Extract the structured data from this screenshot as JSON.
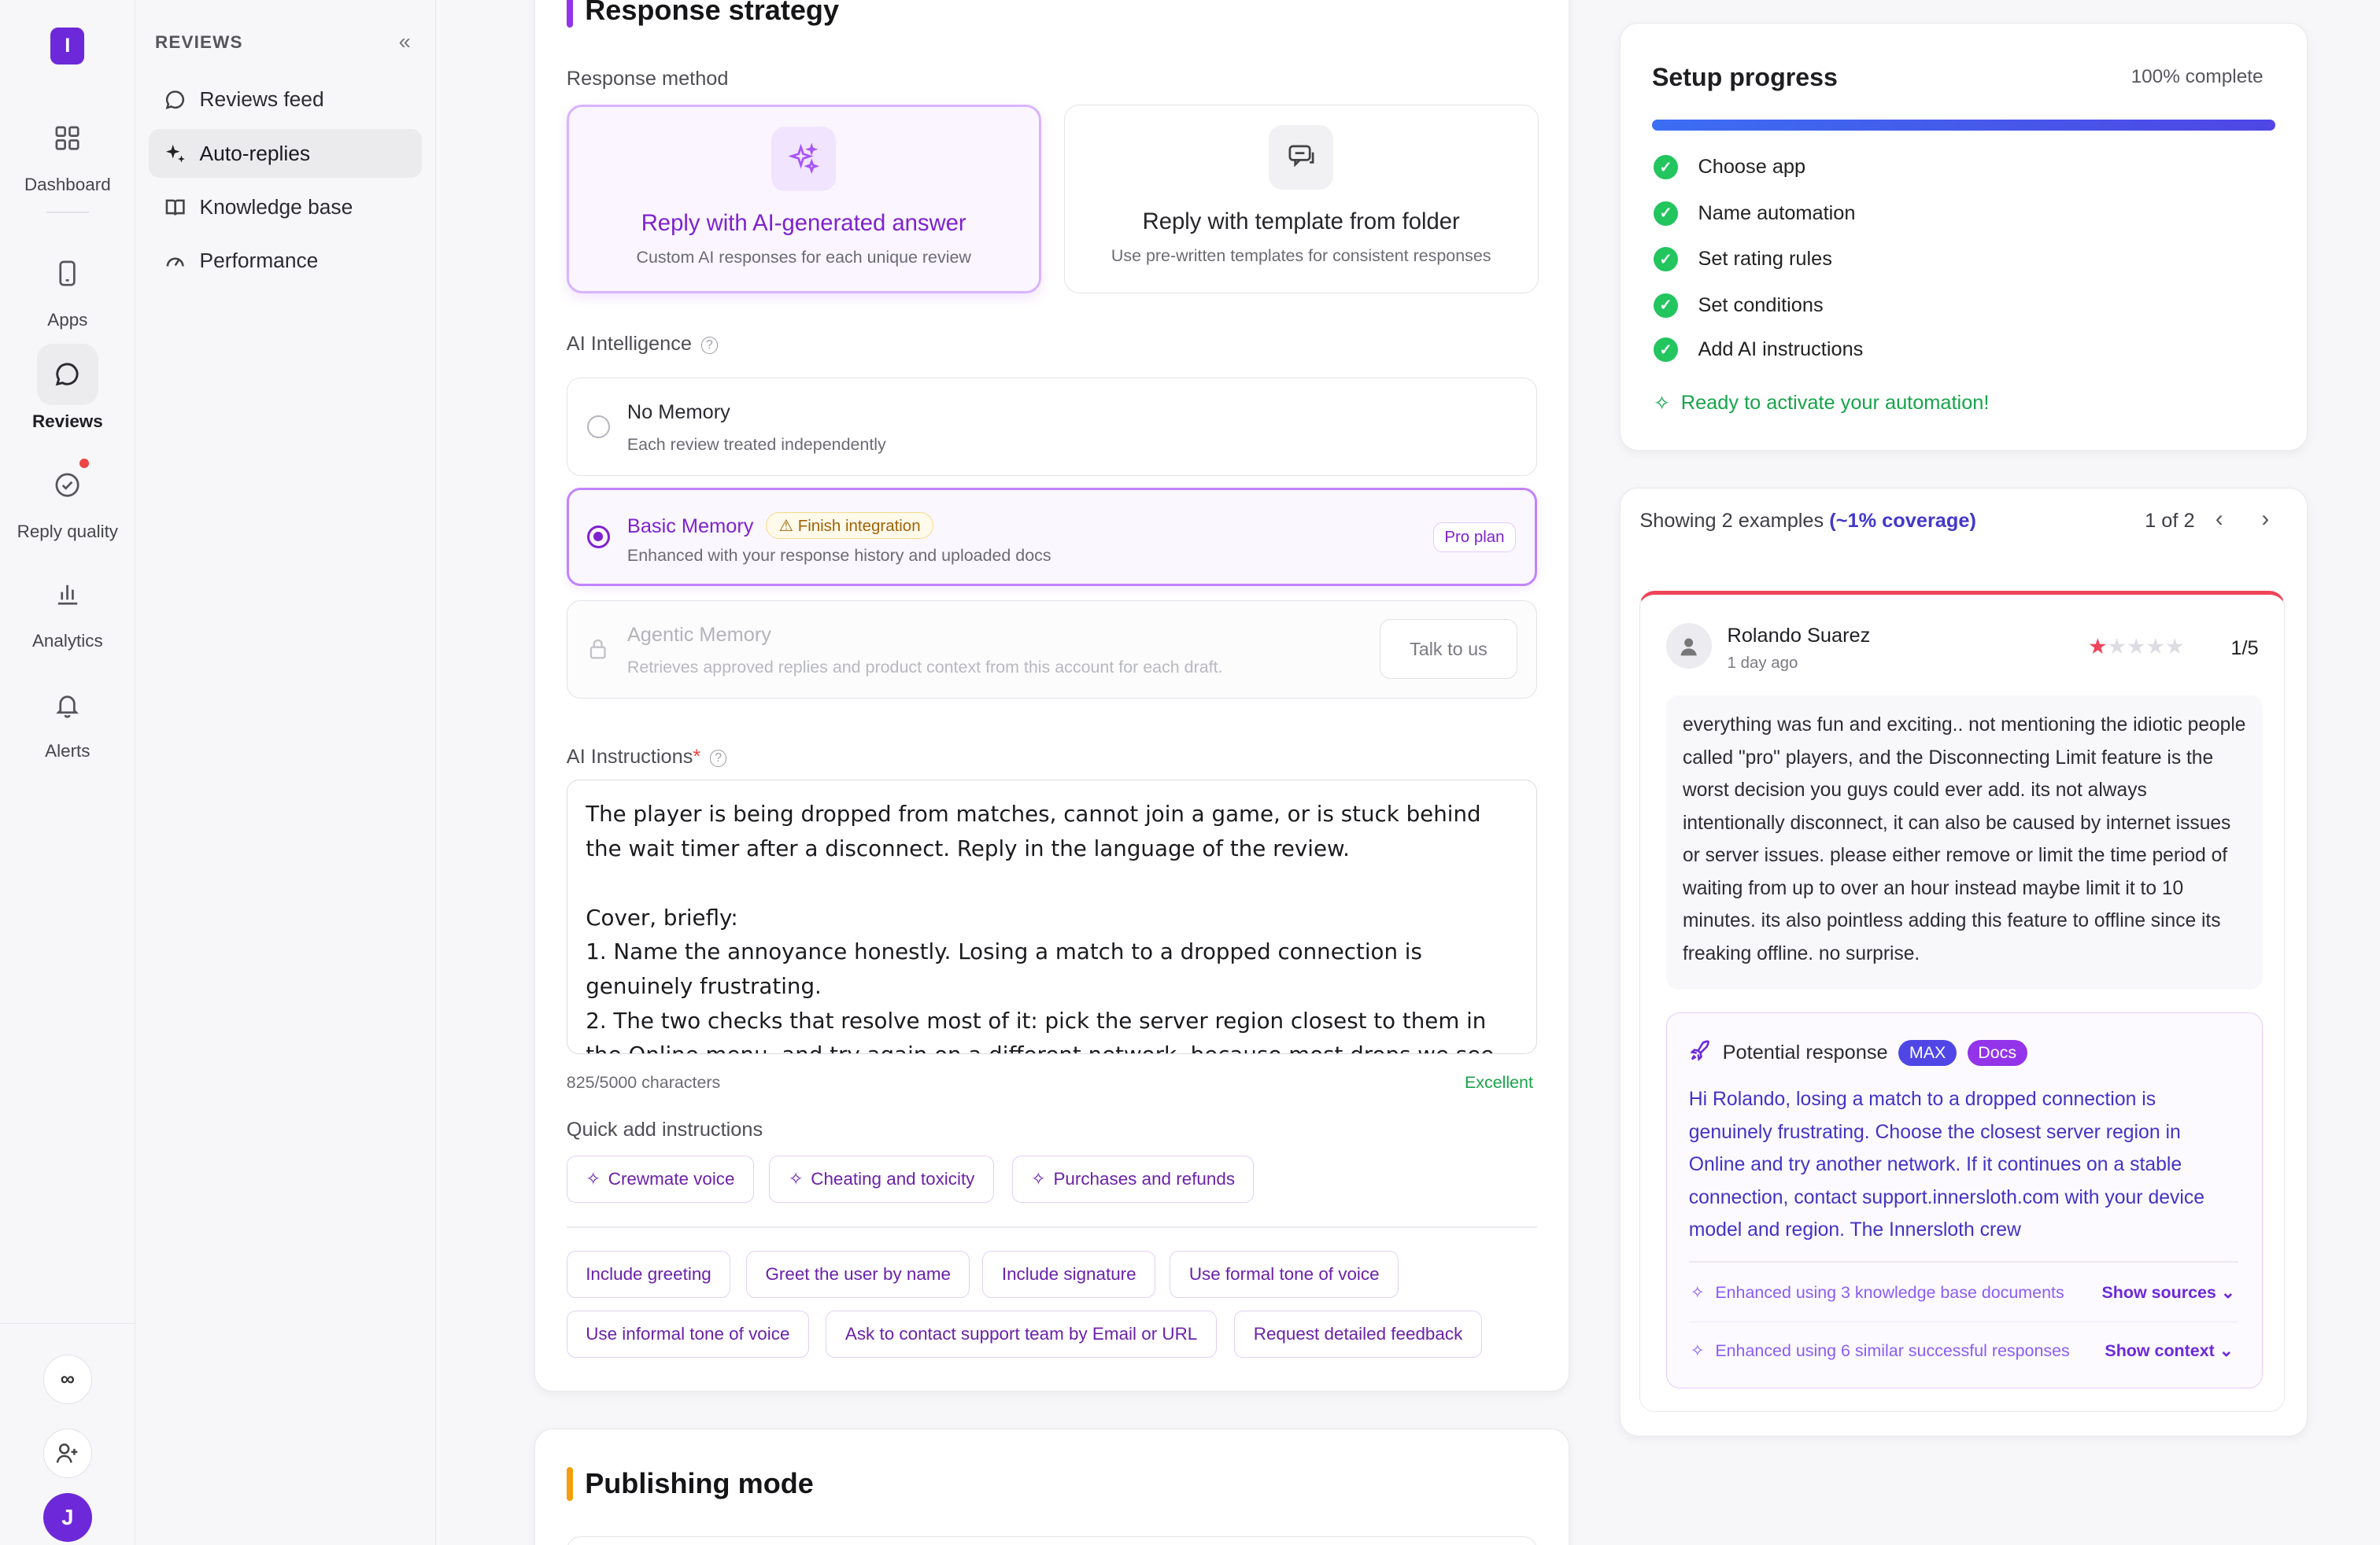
{
  "brand": {
    "letter": "I"
  },
  "rail": {
    "items": [
      {
        "label": "Dashboard"
      },
      {
        "label": "Apps"
      },
      {
        "label": "Reviews"
      },
      {
        "label": "Reply quality"
      },
      {
        "label": "Analytics"
      },
      {
        "label": "Alerts"
      }
    ],
    "infinity": "∞",
    "avatar": "J"
  },
  "subnav": {
    "title": "REVIEWS",
    "items": [
      {
        "label": "Reviews feed"
      },
      {
        "label": "Auto-replies"
      },
      {
        "label": "Knowledge base"
      },
      {
        "label": "Performance"
      }
    ]
  },
  "strategy": {
    "title": "Response strategy",
    "method_label": "Response method",
    "methods": [
      {
        "title": "Reply with AI-generated answer",
        "sub": "Custom AI responses for each unique review"
      },
      {
        "title": "Reply with template from folder",
        "sub": "Use pre-written templates for consistent responses"
      }
    ],
    "intel_label": "AI Intelligence",
    "memory": [
      {
        "title": "No Memory",
        "sub": "Each review treated independently"
      },
      {
        "title": "Basic Memory",
        "badge": "Finish integration",
        "sub": "Enhanced with your response history and uploaded docs",
        "plan": "Pro plan"
      },
      {
        "title": "Agentic Memory",
        "sub": "Retrieves approved replies and product context from this account for each draft.",
        "cta": "Talk to us"
      }
    ],
    "instructions_label": "AI Instructions",
    "instructions_text": "The player is being dropped from matches, cannot join a game, or is stuck behind the wait timer after a disconnect. Reply in the language of the review.\n\nCover, briefly:\n1. Name the annoyance honestly. Losing a match to a dropped connection is genuinely frustrating.\n2. The two checks that resolve most of it: pick the server region closest to them in the Online menu, and try again on a different network, because most drops we see are the",
    "counter": "825/5000 characters",
    "quality": "Excellent",
    "quick_label": "Quick add instructions",
    "quick_ai": [
      "Crewmate voice",
      "Cheating and toxicity",
      "Purchases and refunds"
    ],
    "quick": [
      "Include greeting",
      "Greet the user by name",
      "Include signature",
      "Use formal tone of voice",
      "Use informal tone of voice",
      "Ask to contact support team by Email or URL",
      "Request detailed feedback"
    ]
  },
  "publishing": {
    "title": "Publishing mode"
  },
  "setup": {
    "title": "Setup progress",
    "pct_label": "100% complete",
    "progress": 1.0,
    "steps": [
      "Choose app",
      "Name automation",
      "Set rating rules",
      "Set conditions",
      "Add AI instructions"
    ],
    "ready": "Ready to activate your automation!"
  },
  "examples": {
    "showing": "Showing 2 examples",
    "coverage": "(~1% coverage)",
    "pager": "1 of 2",
    "review": {
      "name": "Rolando Suarez",
      "time": "1 day ago",
      "rating": 1,
      "score": "1/5",
      "body": "everything was fun and exciting.. not mentioning the idiotic people called \"pro\" players, and the Disconnecting Limit feature is the worst decision you guys could ever add. its not always intentionally disconnect, it can also be caused by internet issues or server issues. please either remove or limit the time period of waiting from up to over an hour instead maybe limit it to 10 minutes. its also pointless adding this feature to offline since its freaking offline. no surprise."
    },
    "response": {
      "title": "Potential response",
      "badge1": "MAX",
      "badge2": "Docs",
      "text": "Hi Rolando, losing a match to a dropped connection is genuinely frustrating. Choose the closest server region in Online and try another network. If it continues on a stable connection, contact support.innersloth.com with your device model and region. The Innersloth crew",
      "enh1": "Enhanced using 3 knowledge base documents",
      "show1": "Show sources",
      "enh2": "Enhanced using 6 similar successful responses",
      "show2": "Show context"
    }
  },
  "colors": {
    "accent": "#7e22ce",
    "strategy_bar": "#9333ea",
    "publishing_bar": "#f59e0b",
    "success": "#22c55e",
    "review_top": "#ef4458"
  }
}
